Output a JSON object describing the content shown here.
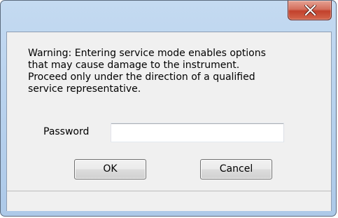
{
  "window": {
    "title": ""
  },
  "titlebar": {
    "close_icon": "close-icon"
  },
  "dialog": {
    "warning_text": "Warning: Entering service mode enables options\nthat may cause damage to the instrument.\nProceed only under the direction of a qualified\nservice representative.",
    "password_label": "Password",
    "password_value": "",
    "ok_label": "OK",
    "cancel_label": "Cancel"
  },
  "colors": {
    "titlebar": "#bad3ee",
    "close_button": "#c7503c",
    "client_background": "#f0f0f0"
  }
}
